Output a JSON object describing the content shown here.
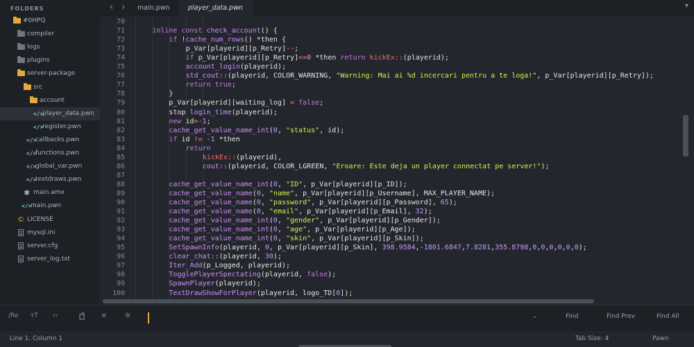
{
  "sidebar": {
    "header": "FOLDERS",
    "items": [
      {
        "label": "#0HPQ",
        "icon": "folder-open-icon"
      },
      {
        "label": "compiler",
        "icon": "folder-icon"
      },
      {
        "label": "logs",
        "icon": "folder-icon"
      },
      {
        "label": "plugins",
        "icon": "folder-icon"
      },
      {
        "label": "server-package",
        "icon": "folder-open-icon"
      },
      {
        "label": "src",
        "icon": "folder-open-icon"
      },
      {
        "label": "account",
        "icon": "folder-open-icon"
      },
      {
        "label": "player_data.pwn",
        "icon": "code-file-icon",
        "icon_glyph": "</>",
        "selected": true
      },
      {
        "label": "register.pwn",
        "icon": "code-file-icon",
        "icon_glyph": "</>"
      },
      {
        "label": "callbacks.pwn",
        "icon": "code-file-icon",
        "icon_glyph": "</>"
      },
      {
        "label": "functions.pwn",
        "icon": "code-file-icon",
        "icon_glyph": "</>"
      },
      {
        "label": "global_var.pwn",
        "icon": "code-file-icon",
        "icon_glyph": "</>"
      },
      {
        "label": "textdraws.pwn",
        "icon": "code-file-icon",
        "icon_glyph": "</>"
      },
      {
        "label": "main.amx",
        "icon": "binary-file-icon",
        "icon_glyph": "✱"
      },
      {
        "label": "main.pwn",
        "icon": "code-file-icon",
        "icon_glyph": "</>"
      },
      {
        "label": "LICENSE",
        "icon": "license-icon",
        "icon_glyph": "©"
      },
      {
        "label": "mysql.ini",
        "icon": "text-file-icon"
      },
      {
        "label": "server.cfg",
        "icon": "text-file-icon"
      },
      {
        "label": "server_log.txt",
        "icon": "text-file-icon"
      }
    ]
  },
  "tabs": {
    "back_glyph": "‹",
    "forward_glyph": "›",
    "items": [
      {
        "label": "main.pwn",
        "close": "×",
        "active": false
      },
      {
        "label": "player_data.pwn",
        "close": "×",
        "active": true
      }
    ],
    "menu_glyph": "▾"
  },
  "editor": {
    "lines": [
      {
        "n": "70",
        "indent": 0,
        "t": [
          {
            "c": ""
          }
        ]
      },
      {
        "n": "71",
        "indent": 1,
        "t": [
          {
            "c": "kw",
            "s": "inline const "
          },
          {
            "c": "fn",
            "s": "check_account"
          },
          {
            "c": "",
            "s": "() {"
          }
        ]
      },
      {
        "n": "72",
        "indent": 2,
        "t": [
          {
            "c": "kw",
            "s": "if "
          },
          {
            "c": "",
            "s": "!"
          },
          {
            "c": "fn",
            "s": "cache_num_rows"
          },
          {
            "c": "",
            "s": "() *"
          },
          {
            "c": "",
            "s": "then {"
          }
        ]
      },
      {
        "n": "73",
        "indent": 3,
        "t": [
          {
            "c": "",
            "s": "p_Var[playerid][p_Retry]"
          },
          {
            "c": "op",
            "s": "--"
          },
          {
            "c": "",
            "s": ";"
          }
        ]
      },
      {
        "n": "74",
        "indent": 3,
        "t": [
          {
            "c": "kw",
            "s": "if "
          },
          {
            "c": "",
            "s": "p_Var[playerid][p_Retry]"
          },
          {
            "c": "op",
            "s": "<="
          },
          {
            "c": "num",
            "s": "0"
          },
          {
            "c": "",
            "s": " *then "
          },
          {
            "c": "kw",
            "s": "return "
          },
          {
            "c": "ex",
            "s": "kickEx::"
          },
          {
            "c": "",
            "s": "(playerid);"
          }
        ]
      },
      {
        "n": "75",
        "indent": 3,
        "t": [
          {
            "c": "fn",
            "s": "account_login"
          },
          {
            "c": "",
            "s": "(playerid);"
          }
        ]
      },
      {
        "n": "76",
        "indent": 3,
        "t": [
          {
            "c": "fn",
            "s": "std_cout::"
          },
          {
            "c": "",
            "s": "(playerid, COLOR_WARNING, "
          },
          {
            "c": "str",
            "s": "\"Warning: Mai ai %d incercari pentru a te loga!\""
          },
          {
            "c": "",
            "s": ", p_Var[playerid][p_Retry]);"
          }
        ]
      },
      {
        "n": "77",
        "indent": 3,
        "t": [
          {
            "c": "kw",
            "s": "return "
          },
          {
            "c": "kw",
            "s": "true"
          },
          {
            "c": "",
            "s": ";"
          }
        ]
      },
      {
        "n": "78",
        "indent": 2,
        "t": [
          {
            "c": "",
            "s": "}"
          }
        ]
      },
      {
        "n": "79",
        "indent": 2,
        "t": [
          {
            "c": "",
            "s": "p_Var[playerid][waiting_log] "
          },
          {
            "c": "op",
            "s": "="
          },
          {
            "c": "",
            "s": " "
          },
          {
            "c": "kw",
            "s": "false"
          },
          {
            "c": "",
            "s": ";"
          }
        ]
      },
      {
        "n": "80",
        "indent": 2,
        "t": [
          {
            "c": "",
            "s": "stop "
          },
          {
            "c": "fn",
            "s": "login_time"
          },
          {
            "c": "",
            "s": "(playerid);"
          }
        ]
      },
      {
        "n": "81",
        "indent": 2,
        "t": [
          {
            "c": "kwi",
            "s": "new "
          },
          {
            "c": "",
            "s": "id"
          },
          {
            "c": "op",
            "s": "="
          },
          {
            "c": "num",
            "s": "-1"
          },
          {
            "c": "",
            "s": ";"
          }
        ]
      },
      {
        "n": "82",
        "indent": 2,
        "t": [
          {
            "c": "fn",
            "s": "cache_get_value_name_int"
          },
          {
            "c": "",
            "s": "("
          },
          {
            "c": "num",
            "s": "0"
          },
          {
            "c": "",
            "s": ", "
          },
          {
            "c": "str",
            "s": "\"status\""
          },
          {
            "c": "",
            "s": ", id);"
          }
        ]
      },
      {
        "n": "83",
        "indent": 2,
        "t": [
          {
            "c": "kw",
            "s": "if "
          },
          {
            "c": "",
            "s": "id "
          },
          {
            "c": "op",
            "s": "!="
          },
          {
            "c": "",
            "s": " "
          },
          {
            "c": "num",
            "s": "-1"
          },
          {
            "c": "",
            "s": " *then"
          }
        ]
      },
      {
        "n": "84",
        "indent": 3,
        "t": [
          {
            "c": "kw",
            "s": "return"
          }
        ]
      },
      {
        "n": "85",
        "indent": 4,
        "t": [
          {
            "c": "ex",
            "s": "kickEx::"
          },
          {
            "c": "",
            "s": "(playerid),"
          }
        ]
      },
      {
        "n": "86",
        "indent": 4,
        "t": [
          {
            "c": "fn",
            "s": "cout::"
          },
          {
            "c": "",
            "s": "(playerid, COLOR_LGREEN, "
          },
          {
            "c": "str",
            "s": "\"Eroare: Este deja un player connectat pe server!\""
          },
          {
            "c": "",
            "s": ");"
          }
        ]
      },
      {
        "n": "87",
        "indent": 0,
        "t": [
          {
            "c": ""
          }
        ]
      },
      {
        "n": "88",
        "indent": 2,
        "t": [
          {
            "c": "fn",
            "s": "cache_get_value_name_int"
          },
          {
            "c": "",
            "s": "("
          },
          {
            "c": "num",
            "s": "0"
          },
          {
            "c": "",
            "s": ", "
          },
          {
            "c": "str",
            "s": "\"ID\""
          },
          {
            "c": "",
            "s": ", p_Var[playerid][p_ID]);"
          }
        ]
      },
      {
        "n": "89",
        "indent": 2,
        "t": [
          {
            "c": "fn",
            "s": "cache_get_value_name"
          },
          {
            "c": "",
            "s": "("
          },
          {
            "c": "num",
            "s": "0"
          },
          {
            "c": "",
            "s": ", "
          },
          {
            "c": "str",
            "s": "\"name\""
          },
          {
            "c": "",
            "s": ", p_Var[playerid][p_Username], MAX_PLAYER_NAME);"
          }
        ]
      },
      {
        "n": "90",
        "indent": 2,
        "t": [
          {
            "c": "fn",
            "s": "cache_get_value_name"
          },
          {
            "c": "",
            "s": "("
          },
          {
            "c": "num",
            "s": "0"
          },
          {
            "c": "",
            "s": ", "
          },
          {
            "c": "str",
            "s": "\"password\""
          },
          {
            "c": "",
            "s": ", p_Var[playerid][p_Password], "
          },
          {
            "c": "num",
            "s": "65"
          },
          {
            "c": "",
            "s": ");"
          }
        ]
      },
      {
        "n": "91",
        "indent": 2,
        "t": [
          {
            "c": "fn",
            "s": "cache_get_value_name"
          },
          {
            "c": "",
            "s": "("
          },
          {
            "c": "num",
            "s": "0"
          },
          {
            "c": "",
            "s": ", "
          },
          {
            "c": "str",
            "s": "\"email\""
          },
          {
            "c": "",
            "s": ", p_Var[playerid][p_Email], "
          },
          {
            "c": "num",
            "s": "32"
          },
          {
            "c": "",
            "s": ");"
          }
        ]
      },
      {
        "n": "92",
        "indent": 2,
        "t": [
          {
            "c": "fn",
            "s": "cache_get_value_name_int"
          },
          {
            "c": "",
            "s": "("
          },
          {
            "c": "num",
            "s": "0"
          },
          {
            "c": "",
            "s": ", "
          },
          {
            "c": "str",
            "s": "\"gender\""
          },
          {
            "c": "",
            "s": ", p_Var[playerid][p_Gender]);"
          }
        ]
      },
      {
        "n": "93",
        "indent": 2,
        "t": [
          {
            "c": "fn",
            "s": "cache_get_value_name_int"
          },
          {
            "c": "",
            "s": "("
          },
          {
            "c": "num",
            "s": "0"
          },
          {
            "c": "",
            "s": ", "
          },
          {
            "c": "str",
            "s": "\"age\""
          },
          {
            "c": "",
            "s": ", p_Var[playerid][p_Age]);"
          }
        ]
      },
      {
        "n": "94",
        "indent": 2,
        "t": [
          {
            "c": "fn",
            "s": "cache_get_value_name_int"
          },
          {
            "c": "",
            "s": "("
          },
          {
            "c": "num",
            "s": "0"
          },
          {
            "c": "",
            "s": ", "
          },
          {
            "c": "str",
            "s": "\"skin\""
          },
          {
            "c": "",
            "s": ", p_Var[playerid][p_Skin]);"
          }
        ]
      },
      {
        "n": "95",
        "indent": 2,
        "t": [
          {
            "c": "fn",
            "s": "SetSpawnInfo"
          },
          {
            "c": "",
            "s": "(playerid, "
          },
          {
            "c": "num",
            "s": "0"
          },
          {
            "c": "",
            "s": ", p_Var[playerid][p_Skin], "
          },
          {
            "c": "num",
            "s": "398.9584"
          },
          {
            "c": "",
            "s": ","
          },
          {
            "c": "num",
            "s": "-1801.6847"
          },
          {
            "c": "",
            "s": ","
          },
          {
            "c": "num",
            "s": "7.8281"
          },
          {
            "c": "",
            "s": ","
          },
          {
            "c": "num",
            "s": "355.8798"
          },
          {
            "c": "",
            "s": ","
          },
          {
            "c": "num",
            "s": "0"
          },
          {
            "c": "",
            "s": ","
          },
          {
            "c": "num",
            "s": "0"
          },
          {
            "c": "",
            "s": ","
          },
          {
            "c": "num",
            "s": "0"
          },
          {
            "c": "",
            "s": ","
          },
          {
            "c": "num",
            "s": "0"
          },
          {
            "c": "",
            "s": ","
          },
          {
            "c": "num",
            "s": "0"
          },
          {
            "c": "",
            "s": ","
          },
          {
            "c": "num",
            "s": "0"
          },
          {
            "c": "",
            "s": ");"
          }
        ]
      },
      {
        "n": "96",
        "indent": 2,
        "t": [
          {
            "c": "fn",
            "s": "clear_chat::"
          },
          {
            "c": "",
            "s": "(playerid, "
          },
          {
            "c": "num",
            "s": "30"
          },
          {
            "c": "",
            "s": ");"
          }
        ]
      },
      {
        "n": "97",
        "indent": 2,
        "t": [
          {
            "c": "fn",
            "s": "Iter_Add"
          },
          {
            "c": "",
            "s": "(p_Logged, playerid);"
          }
        ]
      },
      {
        "n": "98",
        "indent": 2,
        "t": [
          {
            "c": "fn",
            "s": "TogglePlayerSpectating"
          },
          {
            "c": "",
            "s": "(playerid, "
          },
          {
            "c": "kw",
            "s": "false"
          },
          {
            "c": "",
            "s": ");"
          }
        ]
      },
      {
        "n": "99",
        "indent": 2,
        "t": [
          {
            "c": "fn",
            "s": "SpawnPlayer"
          },
          {
            "c": "",
            "s": "(playerid);"
          }
        ]
      },
      {
        "n": "100",
        "indent": 2,
        "t": [
          {
            "c": "fn",
            "s": "TextDrawShowForPlayer"
          },
          {
            "c": "",
            "s": "(playerid, logo_TD["
          },
          {
            "c": "num",
            "s": "0"
          },
          {
            "c": "",
            "s": "]);"
          }
        ]
      }
    ]
  },
  "findbar": {
    "regex": "/Re",
    "case": "тT",
    "word": "‹›",
    "wrap": "wrap",
    "in_selection": "≡",
    "highlight": "☼",
    "input_value": "",
    "dropdown": "⌄",
    "find": "Find",
    "find_prev": "Find Prev",
    "find_all": "Find All"
  },
  "status": {
    "position": "Line 1, Column 1",
    "tab_size": "Tab Size: 4",
    "syntax": "Pawn"
  }
}
